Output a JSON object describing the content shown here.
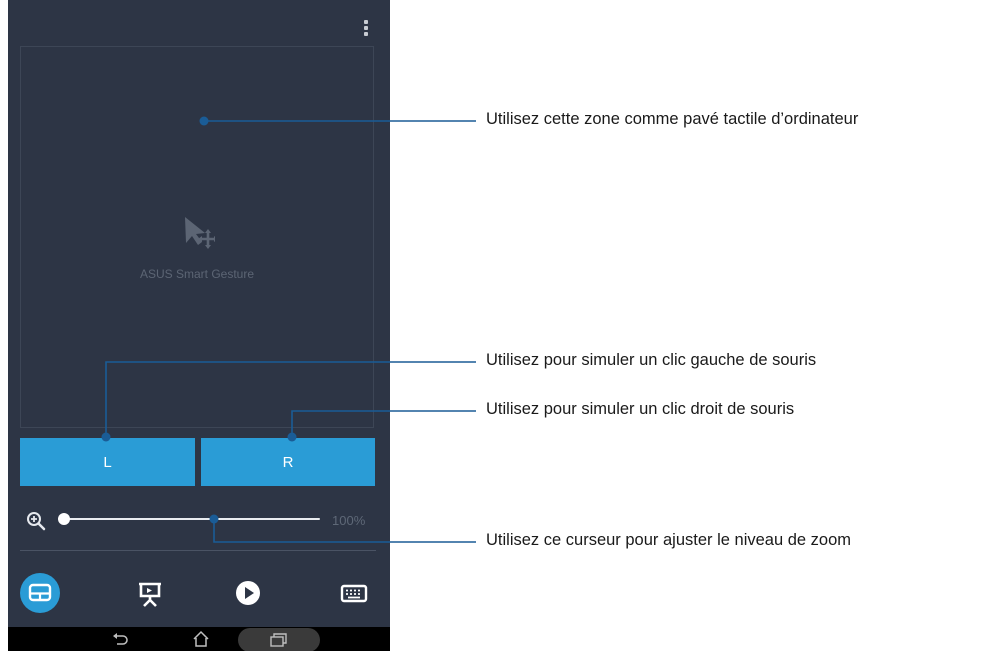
{
  "app": {
    "name": "ASUS Smart Gesture",
    "menu_icon": "more-vertical-icon"
  },
  "touchpad": {
    "icon": "pointer-move-icon",
    "label": "ASUS Smart Gesture"
  },
  "buttons": {
    "left_label": "L",
    "right_label": "R"
  },
  "zoom": {
    "icon": "zoom-in-icon",
    "value_label": "100%",
    "level_percent": 100,
    "slider_position": 0
  },
  "bottom_nav": [
    {
      "name": "touchpad-tab",
      "icon": "touchpad-icon",
      "active": true
    },
    {
      "name": "presentation-tab",
      "icon": "presentation-icon",
      "active": false
    },
    {
      "name": "media-tab",
      "icon": "play-icon",
      "active": false
    },
    {
      "name": "keyboard-tab",
      "icon": "keyboard-icon",
      "active": false
    }
  ],
  "system_bar": [
    "back-icon",
    "home-icon",
    "recents-icon"
  ],
  "callouts": [
    {
      "text": "Utilisez cette zone comme pavé tactile d’ordinateur"
    },
    {
      "text": "Utilisez pour simuler un clic gauche de souris"
    },
    {
      "text": "Utilisez pour simuler un clic droit de souris"
    },
    {
      "text": "Utilisez ce curseur pour ajuster le niveau de zoom"
    }
  ],
  "colors": {
    "screen_bg": "#2d3545",
    "accent": "#2a9cd6",
    "callout_line": "#1a5c96",
    "text": "#1a1a1a"
  }
}
